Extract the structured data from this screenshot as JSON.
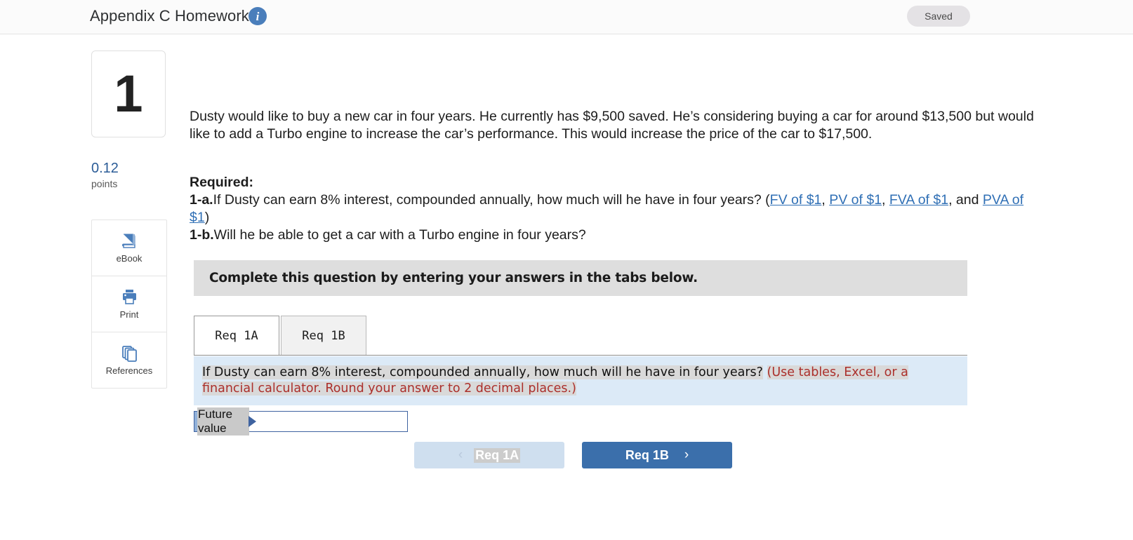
{
  "header": {
    "title": "Appendix C Homework",
    "info_icon": "info-icon",
    "save_status": "Saved"
  },
  "sidebar": {
    "question_number": "1",
    "points_value": "0.12",
    "points_label": "points",
    "tools": [
      {
        "label": "eBook",
        "icon": "book-icon"
      },
      {
        "label": "Print",
        "icon": "printer-icon"
      },
      {
        "label": "References",
        "icon": "pages-icon"
      }
    ]
  },
  "question": {
    "stem": "Dusty would like to buy a new car in four years. He currently has $9,500 saved. He’s considering buying a car for around $13,500 but would like to add a Turbo engine to increase the car’s performance. This would increase the price of the car to $17,500.",
    "required_heading": "Required:",
    "part_a_label": "1-a.",
    "part_a_text": "If Dusty can earn 8% interest, compounded annually, how much will he have in four years? (",
    "links": [
      {
        "text": "FV of $1"
      },
      {
        "text": "PV of $1"
      },
      {
        "text": "FVA of $1"
      },
      {
        "text": "PVA of $1"
      }
    ],
    "link_sep_1": ", ",
    "link_sep_2": ", ",
    "link_sep_3": ", and ",
    "part_a_close": ")",
    "part_b_label": "1-b.",
    "part_b_text": "Will he be able to get a car with a Turbo engine in four years?"
  },
  "banner": {
    "text": "Complete this question by entering your answers in the tabs below."
  },
  "tabs": [
    {
      "label": "Req 1A",
      "active": true
    },
    {
      "label": "Req 1B",
      "active": false
    }
  ],
  "panel": {
    "prompt": "If Dusty can earn 8% interest, compounded annually, how much will he have in four years?",
    "hint": "(Use tables, Excel, or a financial calculator. Round your answer to 2 decimal places.)"
  },
  "answer": {
    "label": "Future value",
    "value": "",
    "placeholder": ""
  },
  "nav": {
    "prev_label": "Req 1A",
    "prev_chevron": "‹",
    "next_label": "Req 1B",
    "next_chevron": "›"
  },
  "colors": {
    "link": "#2f6fb5",
    "accent_blue": "#3b6fab",
    "panel_blue": "#dceaf7",
    "banner_gray": "#dedede",
    "hint_red": "#ab2f2b",
    "label_blue": "#92b2da"
  }
}
